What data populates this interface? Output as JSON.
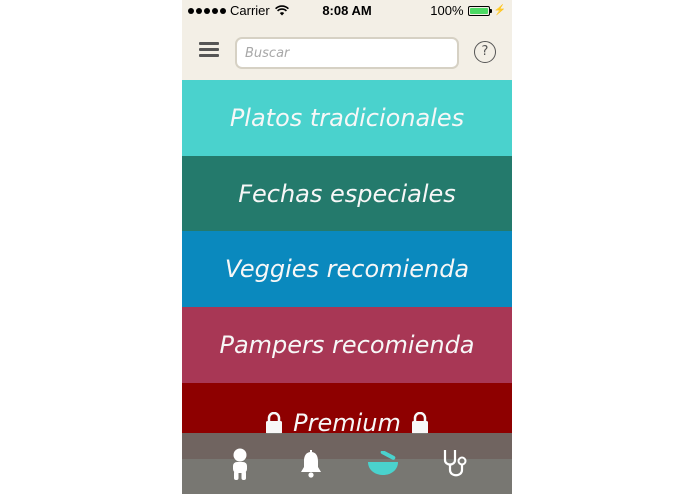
{
  "status_bar": {
    "carrier": "Carrier",
    "time": "8:08 AM",
    "battery": "100%",
    "battery_level": 1.0
  },
  "header": {
    "menu_icon": "hamburger-menu-icon",
    "search_placeholder": "Buscar",
    "help_label": "?"
  },
  "categories": [
    {
      "label": "Platos tradicionales",
      "color": "#4ad2cd"
    },
    {
      "label": "Fechas especiales",
      "color": "#247a6c"
    },
    {
      "label": "Veggies recomienda",
      "color": "#0a89be"
    },
    {
      "label": "Pampers recomienda",
      "color": "#a83755"
    },
    {
      "label": "Premium",
      "color": "#8e0000",
      "icon": "lock-icon"
    }
  ],
  "tabs": [
    {
      "icon": "baby-icon",
      "active": false
    },
    {
      "icon": "bell-icon",
      "active": false
    },
    {
      "icon": "mortar-pestle-icon",
      "active": true
    },
    {
      "icon": "stethoscope-icon",
      "active": false
    }
  ],
  "colors": {
    "tab_active": "#4ad2cd",
    "tab_inactive": "#ffffff",
    "header_bg": "#f3efe6"
  }
}
